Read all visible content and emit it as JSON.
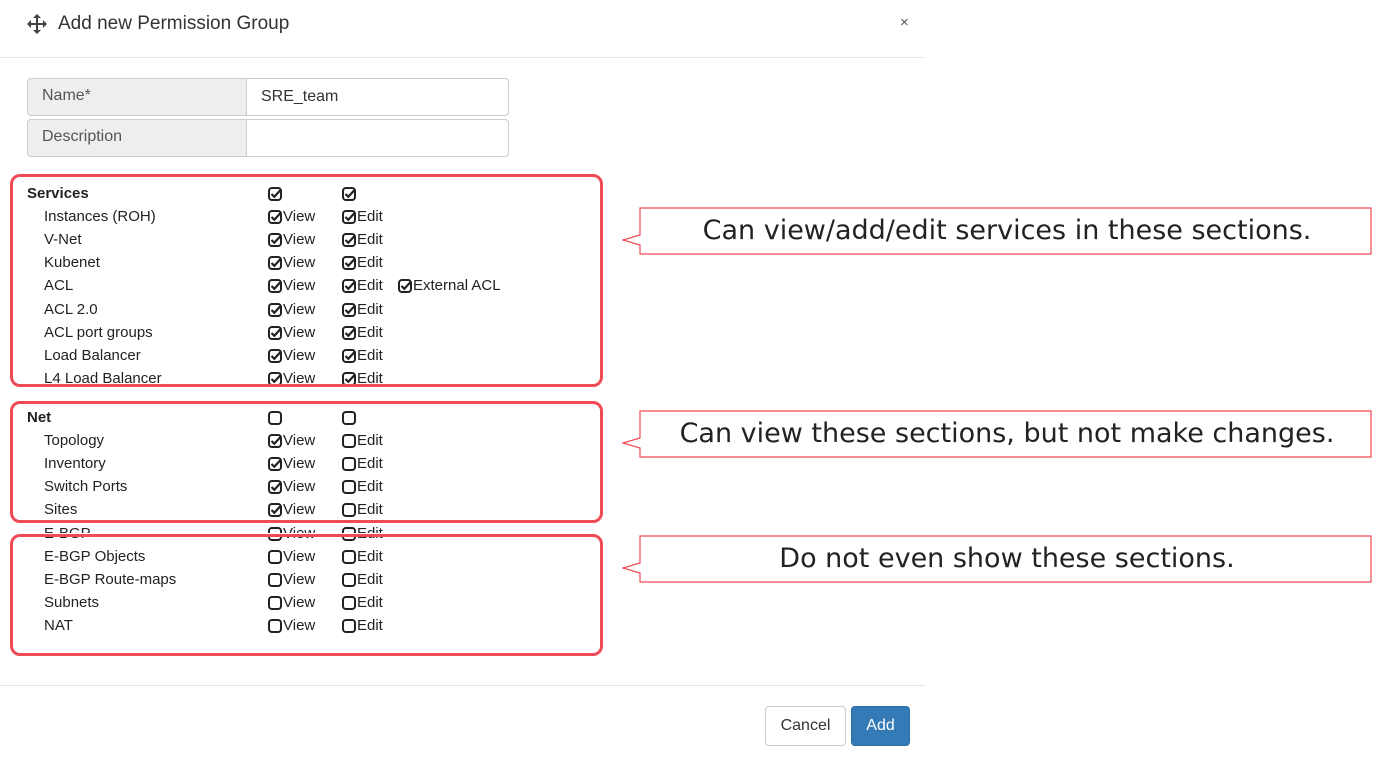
{
  "dialog": {
    "title": "Add new Permission Group",
    "close": "×"
  },
  "form": {
    "name_label": "Name*",
    "name_value": "SRE_team",
    "description_label": "Description",
    "description_value": ""
  },
  "permissions": {
    "view_label": "View",
    "edit_label": "Edit",
    "external_acl_label": "External ACL",
    "services": {
      "label": "Services",
      "items": [
        {
          "name": "Instances (ROH)"
        },
        {
          "name": "V-Net"
        },
        {
          "name": "Kubenet"
        },
        {
          "name": "ACL"
        },
        {
          "name": "ACL 2.0"
        },
        {
          "name": "ACL port groups"
        },
        {
          "name": "Load Balancer"
        },
        {
          "name": "L4 Load Balancer"
        }
      ]
    },
    "net": {
      "label": "Net",
      "items": [
        {
          "name": "Topology"
        },
        {
          "name": "Inventory"
        },
        {
          "name": "Switch Ports"
        },
        {
          "name": "Sites"
        },
        {
          "name": "E-BGP"
        },
        {
          "name": "E-BGP Objects"
        },
        {
          "name": "E-BGP Route-maps"
        },
        {
          "name": "Subnets"
        },
        {
          "name": "NAT"
        }
      ]
    }
  },
  "annotations": [
    {
      "text": "Can view/add/edit services in these sections."
    },
    {
      "text": "Can view these sections, but not make changes."
    },
    {
      "text": "Do not even show these sections."
    }
  ],
  "footer": {
    "cancel": "Cancel",
    "add": "Add"
  },
  "colors": {
    "highlight": "#ef4a55",
    "primary": "#337ab7"
  }
}
